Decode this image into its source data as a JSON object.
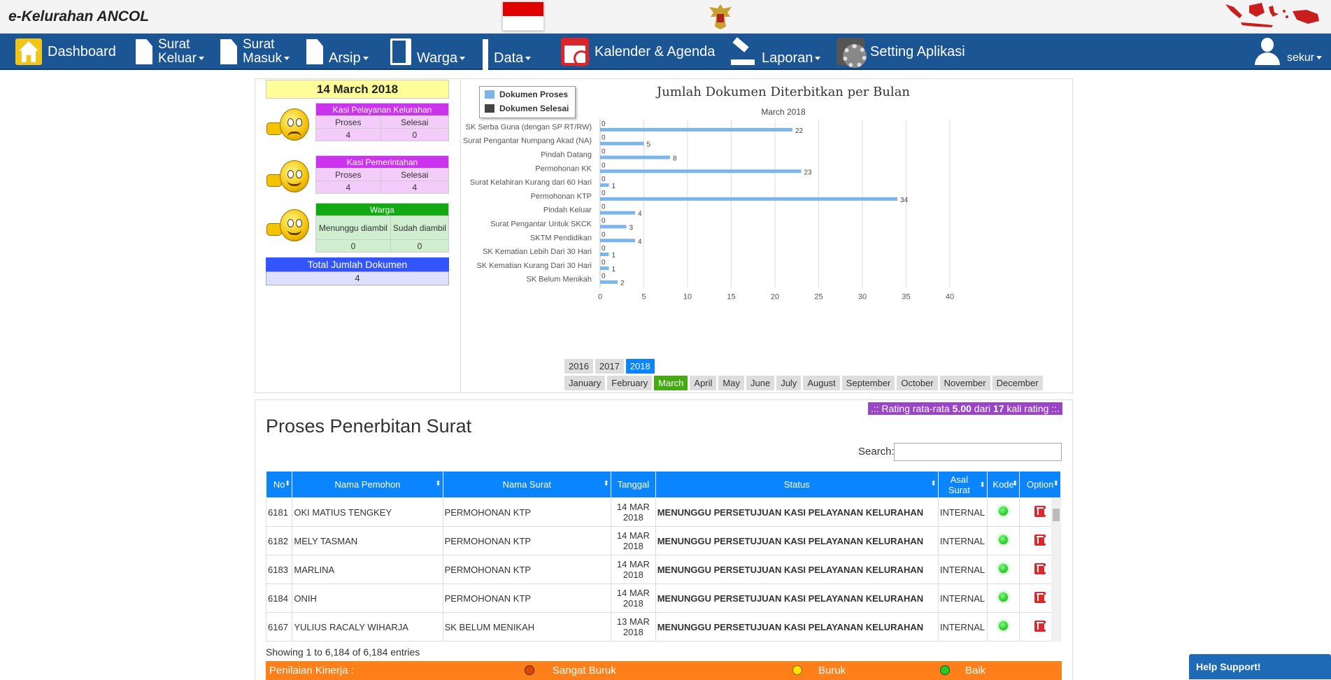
{
  "app_title": "e-Kelurahan ANCOL",
  "nav": {
    "dashboard": "Dashboard",
    "surat_keluar_1": "Surat",
    "surat_keluar_2": "Keluar",
    "surat_masuk_1": "Surat",
    "surat_masuk_2": "Masuk",
    "arsip": "Arsip",
    "warga": "Warga",
    "data": "Data",
    "kalender": "Kalender & Agenda",
    "laporan": "Laporan",
    "setting": "Setting Aplikasi",
    "user": "sekur"
  },
  "summary": {
    "date": "14 March 2018",
    "kasi_pelayanan": {
      "title": "Kasi Pelayanan Kelurahan",
      "col1": "Proses",
      "col2": "Selesai",
      "val1": "4",
      "val2": "0",
      "color": "#cc33ee"
    },
    "kasi_pemerintahan": {
      "title": "Kasi Pemerintahan",
      "col1": "Proses",
      "col2": "Selesai",
      "val1": "4",
      "val2": "4",
      "color": "#cc33ee"
    },
    "warga": {
      "title": "Warga",
      "col1": "Menunggu diambil",
      "col2": "Sudah diambil",
      "val1": "0",
      "val2": "0",
      "color": "#11aa11"
    },
    "total_label": "Total Jumlah Dokumen",
    "total_value": "4"
  },
  "chart_data": {
    "type": "bar",
    "orientation": "horizontal",
    "title": "Jumlah Dokumen Diterbitkan per Bulan",
    "subtitle": "March 2018",
    "categories": [
      "SK Serba Guna (dengan SP RT/RW)",
      "Surat Pengantar Numpang Akad (NA)",
      "Pindah Datang",
      "Permohonan KK",
      "Surat Kelahiran Kurang dari 60 Hari",
      "Permohonan KTP",
      "Pindah Keluar",
      "Surat Pengantar Untuk SKCK",
      "SKTM Pendidikan",
      "SK Kematian Lebih Dari 30 Hari",
      "SK Kematian Kurang Dari 30 Hari",
      "SK Belum Menikah"
    ],
    "series": [
      {
        "name": "Dokumen Proses",
        "color": "#7cb5ec",
        "values": [
          22,
          5,
          8,
          23,
          1,
          34,
          4,
          3,
          4,
          1,
          1,
          2
        ]
      },
      {
        "name": "Dokumen Selesai",
        "color": "#434348",
        "values": [
          0,
          0,
          0,
          0,
          0,
          0,
          0,
          0,
          0,
          0,
          0,
          0
        ]
      }
    ],
    "xlim": [
      0,
      40
    ],
    "xticks": [
      "0",
      "5",
      "10",
      "15",
      "20",
      "25",
      "30",
      "35",
      "40"
    ],
    "grid": true,
    "legend": "top-left"
  },
  "years": [
    "2016",
    "2017",
    "2018"
  ],
  "active_year": "2018",
  "months": [
    "January",
    "February",
    "March",
    "April",
    "May",
    "June",
    "July",
    "August",
    "September",
    "October",
    "November",
    "December"
  ],
  "active_month": "March",
  "rating": {
    "prefix": ".:: Rating rata-rata ",
    "value": "5.00",
    "mid": " dari ",
    "count": "17",
    "suffix": " kali rating ::."
  },
  "section_title": "Proses Penerbitan Surat",
  "search_label": "Search:",
  "table": {
    "headers": [
      "No",
      "Nama Pemohon",
      "Nama Surat",
      "Tanggal",
      "Status",
      "Asal Surat",
      "Kode",
      "Option"
    ],
    "rows": [
      {
        "no": "6181",
        "nama": "OKI MATIUS TENGKEY",
        "surat": "PERMOHONAN KTP",
        "tgl1": "14 MAR",
        "tgl2": "2018",
        "status": "MENUNGGU PERSETUJUAN KASI PELAYANAN KELURAHAN",
        "asal": "INTERNAL"
      },
      {
        "no": "6182",
        "nama": "MELY TASMAN",
        "surat": "PERMOHONAN KTP",
        "tgl1": "14 MAR",
        "tgl2": "2018",
        "status": "MENUNGGU PERSETUJUAN KASI PELAYANAN KELURAHAN",
        "asal": "INTERNAL"
      },
      {
        "no": "6183",
        "nama": "MARLINA",
        "surat": "PERMOHONAN KTP",
        "tgl1": "14 MAR",
        "tgl2": "2018",
        "status": "MENUNGGU PERSETUJUAN KASI PELAYANAN KELURAHAN",
        "asal": "INTERNAL"
      },
      {
        "no": "6184",
        "nama": "ONIH",
        "surat": "PERMOHONAN KTP",
        "tgl1": "14 MAR",
        "tgl2": "2018",
        "status": "MENUNGGU PERSETUJUAN KASI PELAYANAN KELURAHAN",
        "asal": "INTERNAL"
      },
      {
        "no": "6167",
        "nama": "YULIUS RACALY WIHARJA",
        "surat": "SK BELUM MENIKAH",
        "tgl1": "13 MAR",
        "tgl2": "2018",
        "status": "MENUNGGU PERSETUJUAN KASI PELAYANAN KELURAHAN",
        "asal": "INTERNAL"
      }
    ]
  },
  "showing": "Showing 1 to 6,184 of 6,184 entries",
  "perf": {
    "label": "Penilaian Kinerja :",
    "opt1": "Sangat Buruk",
    "opt2": "Buruk",
    "opt3": "Baik"
  },
  "help": "Help Support!"
}
